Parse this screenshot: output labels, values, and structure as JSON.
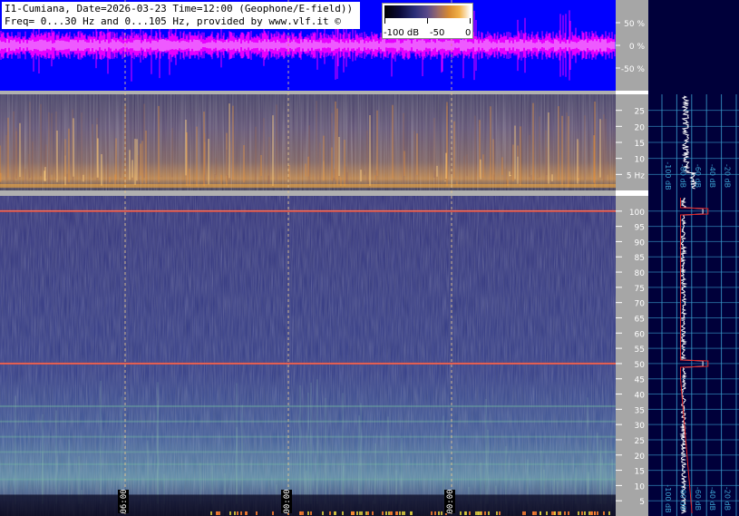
{
  "header": {
    "title_line1": "I1-Cumiana, Date=2026-03-23 Time=12:00 (Geophone/E-field))",
    "title_line2": "Freq= 0...30 Hz and 0...105 Hz, provided by www.vlf.it ©"
  },
  "colorbar": {
    "labels": [
      "-100 dB",
      "-50",
      "0"
    ],
    "colors": [
      "#000000",
      "#2a2e78",
      "#d88a30",
      "#ffffff"
    ]
  },
  "chart_data": [
    {
      "type": "line",
      "name": "waveform",
      "y_tick_labels": [
        "50 %",
        "0 %",
        "-50 %"
      ],
      "ylim": [
        -100,
        100
      ],
      "background": "#0000ff",
      "trace_color": "#ff00ff"
    },
    {
      "type": "heatmap",
      "name": "spectrogram_0_30Hz",
      "y_tick_labels": [
        "25",
        "20",
        "15",
        "10",
        "5 Hz"
      ],
      "y_ticks": [
        25,
        20,
        15,
        10,
        5
      ],
      "ylim": [
        0,
        30
      ]
    },
    {
      "type": "heatmap",
      "name": "spectrogram_0_105Hz",
      "y_tick_labels": [
        "100",
        "95",
        "90",
        "85",
        "80",
        "75",
        "70",
        "65",
        "60",
        "55",
        "50",
        "45",
        "40",
        "35",
        "30",
        "25",
        "20",
        "15",
        "10",
        "5"
      ],
      "y_ticks": [
        100,
        95,
        90,
        85,
        80,
        75,
        70,
        65,
        60,
        55,
        50,
        45,
        40,
        35,
        30,
        25,
        20,
        15,
        10,
        5
      ],
      "ylim": [
        0,
        105
      ],
      "lines_hz": [
        100,
        50
      ],
      "time_markers": [
        "06:00",
        "00:00",
        "00:00"
      ]
    },
    {
      "type": "line",
      "name": "spectrum_profile",
      "x_tick_labels": [
        "-100 dB",
        "-80 dB",
        "-60 dB",
        "-40 dB",
        "-20 dB",
        "0 dB"
      ],
      "xlim": [
        -100,
        0
      ]
    }
  ]
}
